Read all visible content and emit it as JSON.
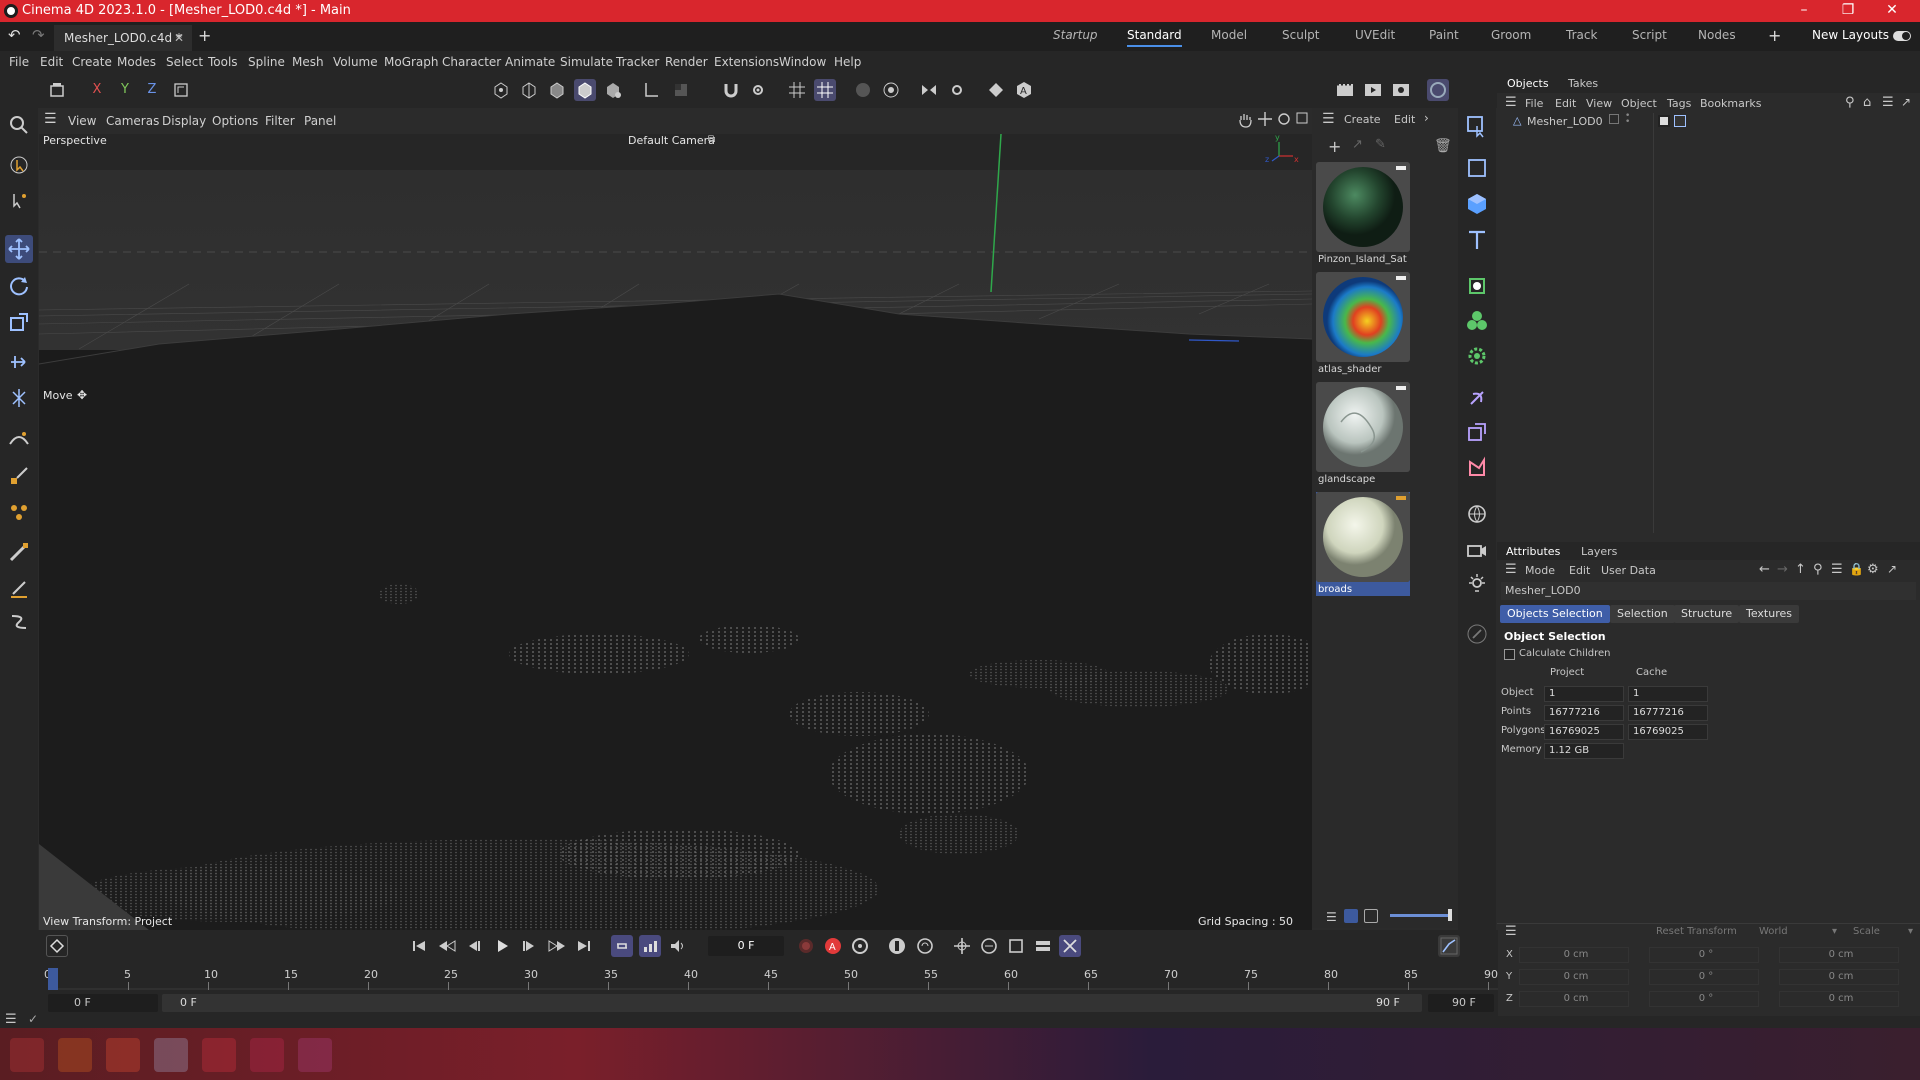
{
  "titlebar": {
    "title": "Cinema 4D 2023.1.0 - [Mesher_LOD0.c4d *] - Main"
  },
  "doc_tab": {
    "name": "Mesher_LOD0.c4d *"
  },
  "layouts": {
    "items": [
      "Startup",
      "Standard",
      "Model",
      "Sculpt",
      "UVEdit",
      "Paint",
      "Groom",
      "Track",
      "Script",
      "Nodes"
    ],
    "active": "Standard",
    "new_layouts": "New Layouts"
  },
  "menu": [
    "File",
    "Edit",
    "Create",
    "Modes",
    "Select",
    "Tools",
    "Spline",
    "Mesh",
    "Volume",
    "MoGraph",
    "Character",
    "Animate",
    "Simulate",
    "Tracker",
    "Render",
    "Extensions",
    "Window",
    "Help"
  ],
  "axis_toggles": {
    "x": "X",
    "y": "Y",
    "z": "Z"
  },
  "viewport_menu": [
    "View",
    "Cameras",
    "Display",
    "Options",
    "Filter",
    "Panel"
  ],
  "viewport": {
    "name": "Perspective",
    "camera": "Default Camera",
    "tool": "Move",
    "view_transform": "View Transform: Project",
    "grid_spacing": "Grid Spacing : 50 cm"
  },
  "material_panel": {
    "menu": [
      "Create",
      "Edit"
    ],
    "materials": [
      {
        "name": "Pinzon_Island_Sat",
        "color": "#2e5a3c"
      },
      {
        "name": "atlas_shader",
        "color": "#49b84a"
      },
      {
        "name": "glandscape",
        "color": "#c9d2cc"
      },
      {
        "name": "broads",
        "color": "#d8ddc8",
        "selected": true
      }
    ]
  },
  "object_manager": {
    "tabs": [
      "Objects",
      "Takes"
    ],
    "active_tab": "Objects",
    "menu": [
      "File",
      "Edit",
      "View",
      "Object",
      "Tags",
      "Bookmarks"
    ],
    "objects": [
      {
        "name": "Mesher_LOD0"
      }
    ]
  },
  "attributes": {
    "tabs": [
      "Attributes",
      "Layers"
    ],
    "active_tab": "Attributes",
    "menu": [
      "Mode",
      "Edit",
      "User Data"
    ],
    "object_name": "Mesher_LOD0",
    "sub_tabs": [
      "Objects Selection",
      "Selection",
      "Structure",
      "Textures"
    ],
    "active_sub_tab": "Objects Selection",
    "section_title": "Object Selection",
    "calculate_children": "Calculate Children",
    "col_project": "Project",
    "col_cache": "Cache",
    "rows": [
      {
        "label": "Object",
        "project": "1",
        "cache": "1"
      },
      {
        "label": "Points",
        "project": "16777216",
        "cache": "16777216"
      },
      {
        "label": "Polygons",
        "project": "16769025",
        "cache": "16769025"
      },
      {
        "label": "Memory",
        "project": "1.12 GB",
        "cache": ""
      }
    ]
  },
  "coordinates": {
    "reset_transform": "Reset Transform",
    "space": "World",
    "mode": "Scale",
    "rows": [
      {
        "axis": "X",
        "pos": "0 cm",
        "rot": "0 °",
        "size": "0 cm"
      },
      {
        "axis": "Y",
        "pos": "0 cm",
        "rot": "0 °",
        "size": "0 cm"
      },
      {
        "axis": "Z",
        "pos": "0 cm",
        "rot": "0 °",
        "size": "0 cm"
      }
    ]
  },
  "timeline": {
    "current_frame": "0 F",
    "ruler": [
      "0",
      "5",
      "10",
      "15",
      "20",
      "25",
      "30",
      "35",
      "40",
      "45",
      "50",
      "55",
      "60",
      "65",
      "70",
      "75",
      "80",
      "85",
      "90"
    ],
    "start": "0 F",
    "range_start": "0 F",
    "range_end": "90 F",
    "end": "90 F"
  },
  "colors": {
    "titlebar": "#d9262d",
    "accent": "#4a8fe7",
    "selection": "#3f5ea8"
  }
}
